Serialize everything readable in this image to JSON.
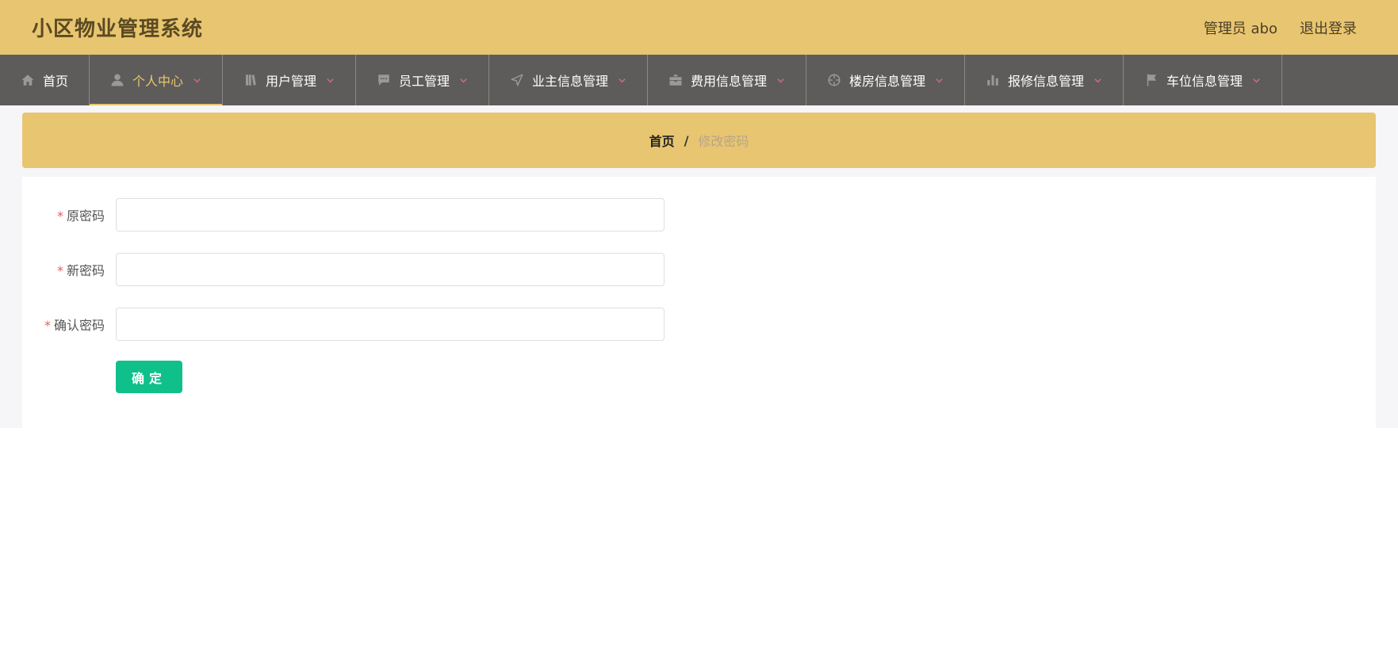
{
  "header": {
    "title": "小区物业管理系统",
    "user_label": "管理员 abo",
    "logout_label": "退出登录",
    "accent_color": "#e8c570"
  },
  "nav": {
    "items": [
      {
        "label": "首页",
        "icon": "home-icon",
        "active": false
      },
      {
        "label": "个人中心",
        "icon": "user-icon",
        "active": true
      },
      {
        "label": "用户管理",
        "icon": "book-icon",
        "active": false
      },
      {
        "label": "员工管理",
        "icon": "chat-icon",
        "active": false
      },
      {
        "label": "业主信息管理",
        "icon": "navigation-icon",
        "active": false
      },
      {
        "label": "费用信息管理",
        "icon": "briefcase-icon",
        "active": false
      },
      {
        "label": "楼房信息管理",
        "icon": "crosshair-icon",
        "active": false
      },
      {
        "label": "报修信息管理",
        "icon": "bar-chart-icon",
        "active": false
      },
      {
        "label": "车位信息管理",
        "icon": "flag-icon",
        "active": false
      }
    ]
  },
  "breadcrumb": {
    "home": "首页",
    "separator": "/",
    "current": "修改密码"
  },
  "form": {
    "required_mark": "*",
    "old_password_label": "原密码",
    "new_password_label": "新密码",
    "confirm_password_label": "确认密码",
    "old_password_value": "",
    "new_password_value": "",
    "confirm_password_value": "",
    "submit_label": "确定",
    "submit_color": "#0fc08a"
  }
}
